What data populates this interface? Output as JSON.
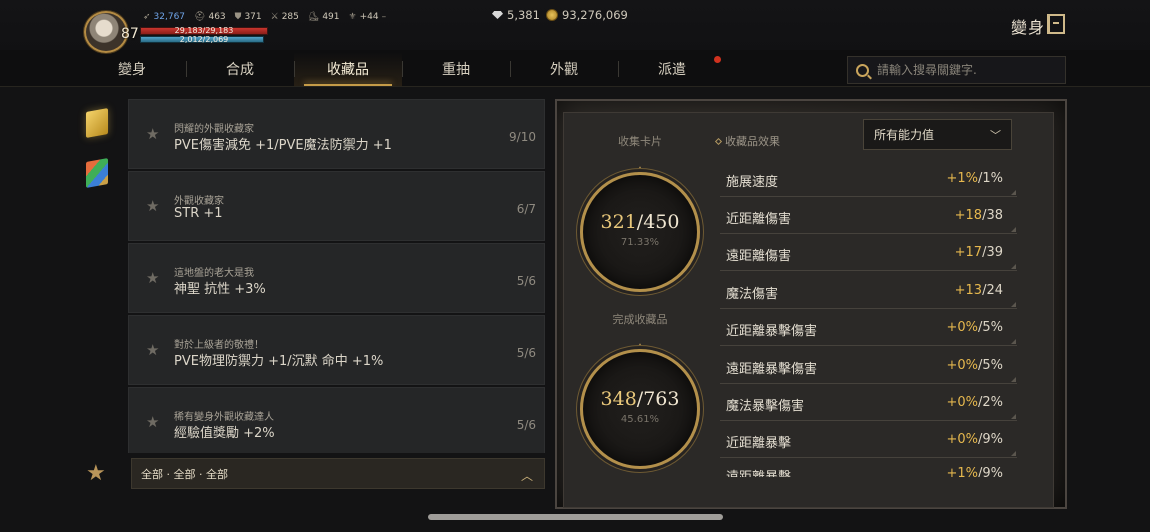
{
  "player": {
    "level": "87",
    "stats": [
      {
        "icon": "feather-icon",
        "value": "32,767"
      },
      {
        "icon": "helmet-icon",
        "value": "463"
      },
      {
        "icon": "armor-icon",
        "value": "371"
      },
      {
        "icon": "sword-icon",
        "value": "285"
      },
      {
        "icon": "boots-icon",
        "value": "491"
      },
      {
        "icon": "wing-icon",
        "value": "+44"
      }
    ],
    "hp_text": "29,183/29,183",
    "hp_fill": 1.0,
    "mp_text": "2,012/2,069",
    "mp_fill": 0.97
  },
  "currency": {
    "gems": "5,381",
    "gold": "93,276,069"
  },
  "header": {
    "title": "變身"
  },
  "tabs": [
    "變身",
    "合成",
    "收藏品",
    "重抽",
    "外觀",
    "派遣"
  ],
  "active_tab": "收藏品",
  "search": {
    "placeholder": "請輸入搜尋關鍵字."
  },
  "collections": [
    {
      "title": "閃耀的外觀收藏家",
      "effect": "PVE傷害減免 +1/PVE魔法防禦力 +1",
      "progress": "9/10"
    },
    {
      "title": "外觀收藏家",
      "effect": "STR +1",
      "progress": "6/7"
    },
    {
      "title": "這地盤的老大是我",
      "effect": "神聖 抗性 +3%",
      "progress": "5/6"
    },
    {
      "title": "對於上級者的敬禮！",
      "effect": "PVE物理防禦力 +1/沉默 命中 +1%",
      "progress": "5/6"
    },
    {
      "title": "稀有變身外觀收藏達人",
      "effect": "經驗值獎勵 +2%",
      "progress": "5/6"
    }
  ],
  "filter": {
    "text": "全部 · 全部 · 全部"
  },
  "summary": {
    "cards_label": "收集卡片",
    "cards_value": "321",
    "cards_total": "/450",
    "cards_pct": "71.33%",
    "done_label": "完成收藏品",
    "done_value": "348",
    "done_total": "/763",
    "done_pct": "45.61%"
  },
  "effects": {
    "label": "收藏品效果",
    "dropdown": "所有能力值",
    "items": [
      {
        "name": "施展速度",
        "plus": "+1%",
        "total": "/1%"
      },
      {
        "name": "近距離傷害",
        "plus": "+18",
        "total": "/38"
      },
      {
        "name": "遠距離傷害",
        "plus": "+17",
        "total": "/39"
      },
      {
        "name": "魔法傷害",
        "plus": "+13",
        "total": "/24"
      },
      {
        "name": "近距離暴擊傷害",
        "plus": "+0%",
        "total": "/5%"
      },
      {
        "name": "遠距離暴擊傷害",
        "plus": "+0%",
        "total": "/5%"
      },
      {
        "name": "魔法暴擊傷害",
        "plus": "+0%",
        "total": "/2%"
      },
      {
        "name": "近距離暴擊",
        "plus": "+0%",
        "total": "/9%"
      },
      {
        "name": "遠距離暴擊",
        "plus": "+1%",
        "total": "/9%"
      }
    ]
  }
}
